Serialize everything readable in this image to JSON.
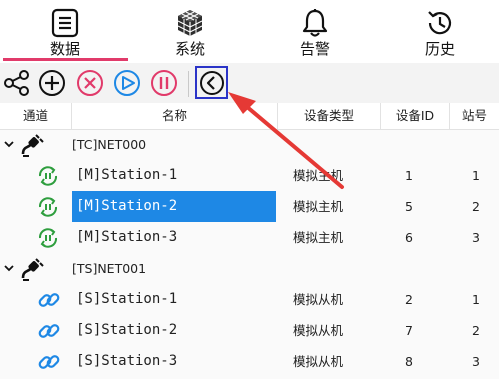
{
  "nav": {
    "tabs": [
      {
        "label": "数据",
        "icon": "data-list-icon",
        "selected": true
      },
      {
        "label": "系统",
        "icon": "system-cube-icon",
        "selected": false
      },
      {
        "label": "告警",
        "icon": "alarm-bell-icon",
        "selected": false
      },
      {
        "label": "历史",
        "icon": "history-clock-icon",
        "selected": false
      }
    ],
    "accent": "#e13a6a"
  },
  "toolbar": {
    "buttons": [
      "share-icon",
      "add-icon",
      "remove-icon",
      "run-icon",
      "pause-icon",
      "back-icon"
    ],
    "active_button": "back-icon",
    "colors": {
      "remove": "#e13a6a",
      "run": "#1e88e5",
      "pause": "#e13a6a",
      "active_border": "#2b34c8",
      "annotation_arrow": "#e53935"
    }
  },
  "table": {
    "headers": {
      "channel": "通道",
      "name": "名称",
      "device_type": "设备类型",
      "device_id": "设备ID",
      "station_no": "站号"
    },
    "groups": [
      {
        "name": "[TC]NET000",
        "icon": "network-plug-icon",
        "rows": [
          {
            "name": "[M]Station-1",
            "type": "模拟主机",
            "id": "1",
            "station": "1",
            "icon": "master-station-icon"
          },
          {
            "name": "[M]Station-2",
            "type": "模拟主机",
            "id": "5",
            "station": "2",
            "icon": "master-station-icon"
          },
          {
            "name": "[M]Station-3",
            "type": "模拟主机",
            "id": "6",
            "station": "3",
            "icon": "master-station-icon"
          }
        ]
      },
      {
        "name": "[TS]NET001",
        "icon": "network-plug-icon",
        "rows": [
          {
            "name": "[S]Station-1",
            "type": "模拟从机",
            "id": "2",
            "station": "1",
            "icon": "slave-link-icon"
          },
          {
            "name": "[S]Station-2",
            "type": "模拟从机",
            "id": "7",
            "station": "2",
            "icon": "slave-link-icon"
          },
          {
            "name": "[S]Station-3",
            "type": "模拟从机",
            "id": "8",
            "station": "3",
            "icon": "slave-link-icon"
          }
        ]
      }
    ],
    "selected_row": "[M]Station-2",
    "selection_color": "#1e88e5"
  }
}
